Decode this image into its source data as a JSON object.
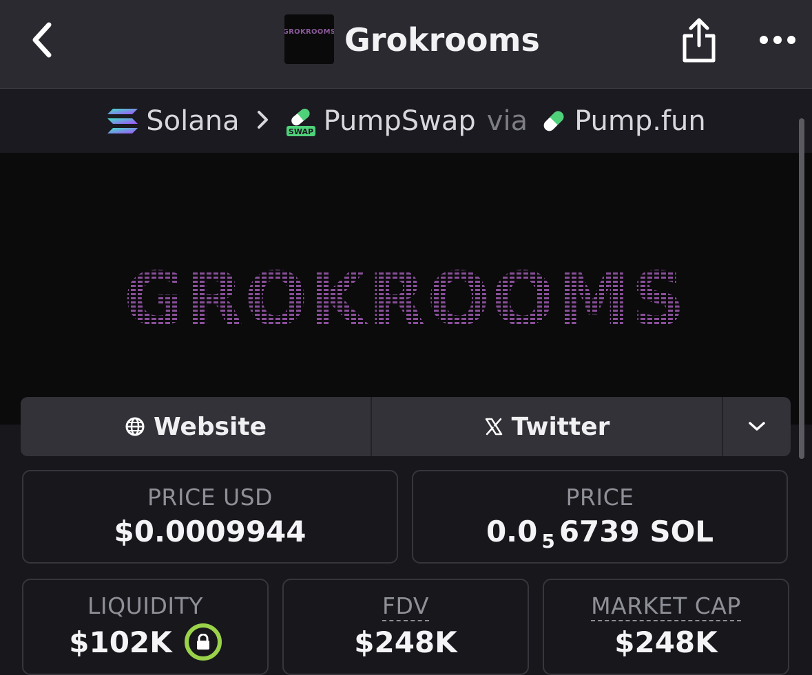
{
  "header": {
    "title": "Grokrooms",
    "logo_text": "GROKROOMS",
    "icons": {
      "back": "chevron-left-icon",
      "share": "share-icon",
      "more": "more-icon"
    }
  },
  "breadcrumb": {
    "chain": "Solana",
    "dex": "PumpSwap",
    "dex_badge": "SWAP",
    "via": "via",
    "launchpad": "Pump.fun"
  },
  "banner": {
    "text": "GROKROOMS",
    "color": "#8a4f9a"
  },
  "links": {
    "website": "Website",
    "twitter": "Twitter"
  },
  "stats": {
    "price_usd": {
      "label": "PRICE USD",
      "value": "$0.0009944"
    },
    "price_native": {
      "label": "PRICE",
      "prefix": "0.0",
      "zeros": "5",
      "suffix": "6739 SOL"
    },
    "liquidity": {
      "label": "LIQUIDITY",
      "value": "$102K"
    },
    "fdv": {
      "label": "FDV",
      "value": "$248K"
    },
    "market_cap": {
      "label": "MARKET CAP",
      "value": "$248K"
    }
  },
  "colors": {
    "background": "#17171c",
    "header": "#2a2a30",
    "accent_lock": "#9ad24a",
    "banner_text": "#8a4f9a"
  }
}
